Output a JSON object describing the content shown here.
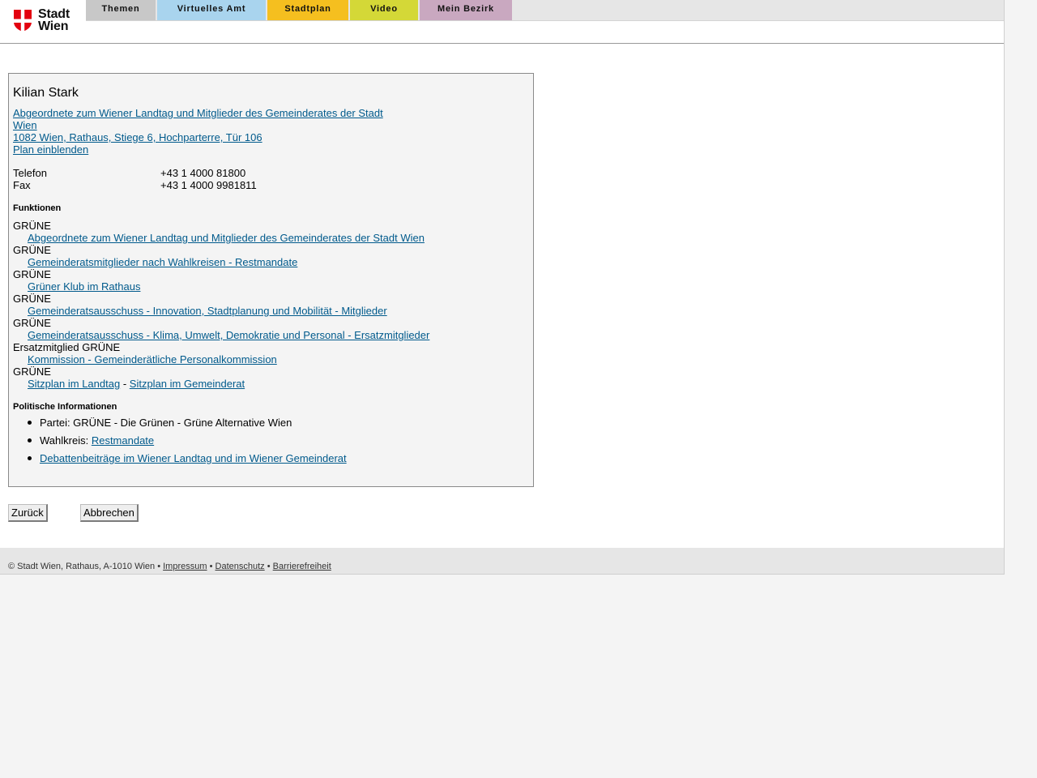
{
  "header": {
    "logo_line1": "Stadt",
    "logo_line2": "Wien",
    "nav": [
      {
        "label": "Themen",
        "color": "#c8c8c8"
      },
      {
        "label": "Virtuelles Amt",
        "color": "#a9d4ee"
      },
      {
        "label": "Stadtplan",
        "color": "#f5bf1f"
      },
      {
        "label": "Video",
        "color": "#d4d837"
      },
      {
        "label": "Mein Bezirk",
        "color": "#c9a8c0"
      }
    ]
  },
  "person": {
    "name": "Kilian Stark",
    "role_link": "Abgeordnete zum Wiener Landtag und Mitglieder des Gemeinderates der Stadt Wien",
    "address_link": "1082 Wien, Rathaus, Stiege 6, Hochparterre, Tür 106",
    "map_link": "Plan einblenden",
    "phone_label": "Telefon",
    "phone_value": "+43 1 4000 81800",
    "fax_label": "Fax",
    "fax_value": "+43 1 4000 9981811"
  },
  "functions": {
    "heading": "Funktionen",
    "items": [
      {
        "party": "GRÜNE",
        "link": "Abgeordnete zum Wiener Landtag und Mitglieder des Gemeinderates der Stadt Wien"
      },
      {
        "party": "GRÜNE",
        "link": "Gemeinderatsmitglieder nach Wahlkreisen - Restmandate"
      },
      {
        "party": "GRÜNE",
        "link": "Grüner Klub im Rathaus"
      },
      {
        "party": "GRÜNE",
        "link": "Gemeinderatsausschuss - Innovation, Stadtplanung und Mobilität - Mitglieder"
      },
      {
        "party": "GRÜNE",
        "link": "Gemeinderatsausschuss - Klima, Umwelt, Demokratie und Personal - Ersatzmitglieder"
      },
      {
        "party": "Ersatzmitglied GRÜNE",
        "link": "Kommission - Gemeinderätliche Personalkommission"
      }
    ],
    "last_party": "GRÜNE",
    "seat_landtag": "Sitzplan im Landtag",
    "seat_separator": "-",
    "seat_gemeinderat": "Sitzplan im Gemeinderat"
  },
  "political": {
    "heading": "Politische Informationen",
    "party_text": "Partei: GRÜNE - Die Grünen - Grüne Alternative Wien",
    "district_label": "Wahlkreis:",
    "district_link": "Restmandate",
    "debates_link": "Debattenbeiträge im Wiener Landtag und im Wiener Gemeinderat"
  },
  "buttons": {
    "back": "Zurück",
    "cancel": "Abbrechen"
  },
  "footer": {
    "copyright": "© Stadt Wien, Rathaus, A-1010 Wien",
    "sep": "•",
    "impressum": "Impressum",
    "datenschutz": "Datenschutz",
    "barrierefreiheit": "Barrierefreiheit"
  }
}
